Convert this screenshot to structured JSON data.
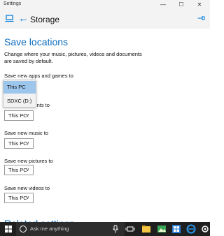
{
  "window": {
    "title": "Settings",
    "minimize": "—",
    "maximize": "☐",
    "close": "✕"
  },
  "header": {
    "back": "←",
    "title": "Storage"
  },
  "main": {
    "section_title": "Save locations",
    "description": "Change where your music, pictures, videos and documents are saved by default.",
    "apps": {
      "label": "Save new apps and games to"
    },
    "dropdown": {
      "options": [
        "This PC",
        "SDXC (D:)"
      ],
      "selected": "This PC"
    },
    "documents": {
      "label_fragment": "uments to",
      "value": "This PC"
    },
    "music": {
      "label": "Save new music to",
      "value": "This PC"
    },
    "pictures": {
      "label": "Save new pictures to",
      "value": "This PC"
    },
    "videos": {
      "label": "Save new videos to",
      "value": "This PC"
    },
    "next_section_partial": "Related settings"
  },
  "taskbar": {
    "search_placeholder": "Ask me anything"
  },
  "icons": {
    "chevron": "∨",
    "accent": "#0078d7"
  }
}
